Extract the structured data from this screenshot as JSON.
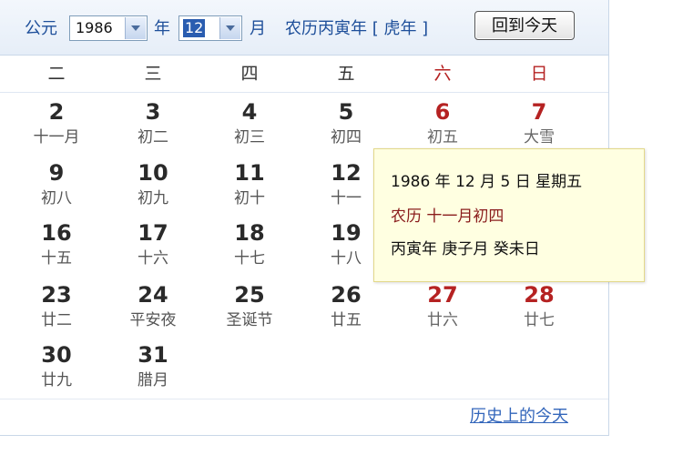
{
  "header": {
    "era_label": "公元",
    "year_value": "1986",
    "year_label": "年",
    "month_value": "12",
    "month_label": "月",
    "lunar_year_text": "农历丙寅年 [ 虎年 ]",
    "today_button": "回到今天"
  },
  "weekdays": [
    "二",
    "三",
    "四",
    "五",
    "六",
    "日"
  ],
  "weeks": [
    [
      {
        "day": "2",
        "lunar": "十一月"
      },
      {
        "day": "3",
        "lunar": "初二"
      },
      {
        "day": "4",
        "lunar": "初三"
      },
      {
        "day": "5",
        "lunar": "初四"
      },
      {
        "day": "6",
        "lunar": "初五"
      },
      {
        "day": "7",
        "lunar": "大雪"
      }
    ],
    [
      {
        "day": "9",
        "lunar": "初八"
      },
      {
        "day": "10",
        "lunar": "初九"
      },
      {
        "day": "11",
        "lunar": "初十"
      },
      {
        "day": "12",
        "lunar": "十一"
      },
      {
        "day": "",
        "lunar": ""
      },
      {
        "day": "",
        "lunar": ""
      }
    ],
    [
      {
        "day": "16",
        "lunar": "十五"
      },
      {
        "day": "17",
        "lunar": "十六"
      },
      {
        "day": "18",
        "lunar": "十七"
      },
      {
        "day": "19",
        "lunar": "十八"
      },
      {
        "day": "",
        "lunar": ""
      },
      {
        "day": "",
        "lunar": ""
      }
    ],
    [
      {
        "day": "23",
        "lunar": "廿二"
      },
      {
        "day": "24",
        "lunar": "平安夜"
      },
      {
        "day": "25",
        "lunar": "圣诞节"
      },
      {
        "day": "26",
        "lunar": "廿五"
      },
      {
        "day": "27",
        "lunar": "廿六"
      },
      {
        "day": "28",
        "lunar": "廿七"
      }
    ],
    [
      {
        "day": "30",
        "lunar": "廿九"
      },
      {
        "day": "31",
        "lunar": "腊月"
      },
      {
        "day": "",
        "lunar": ""
      },
      {
        "day": "",
        "lunar": ""
      },
      {
        "day": "",
        "lunar": ""
      },
      {
        "day": "",
        "lunar": ""
      }
    ]
  ],
  "tooltip": {
    "line1": "1986 年 12 月 5 日 星期五",
    "line2": "农历 十一月初四",
    "line3": "丙寅年 庚子月 癸未日"
  },
  "footer": {
    "history_link": "历史上的今天"
  },
  "colors": {
    "weekend": "#b52222",
    "header_text": "#1e4f9a",
    "tooltip_bg": "#ffffe1",
    "link": "#3366bb"
  }
}
